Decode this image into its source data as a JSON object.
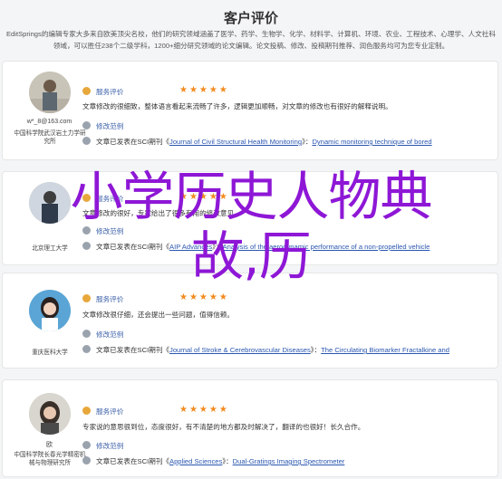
{
  "header": {
    "title": "客户评价",
    "subtitle": "EditSprings的编辑专家大多来自欧美顶尖名校，他们的研究领域涵盖了医学、药学、生物学、化学、材料学、计算机、环境、农业、工程技术、心理学、人文社科领域，可以胜任238个二级学科，1200+细分研究领域的论文编辑。论文投稿、修改、投稿期刊推荐、润色服务均可为您专业定制。"
  },
  "reviews": [
    {
      "user": "w*_8@163.com",
      "org": "中国科学院武汉岩土力学研究所",
      "service_label": "服务评价",
      "rating": 5,
      "stars": "★★★★★",
      "comment": "文章修改的很细致，整体语言看起来流畅了许多，逻辑更加顺畅，对文章的修改也有很好的解释说明。",
      "case_label": "修改范例",
      "pub_prefix": "文章已发表在SCI期刊",
      "journal": "Journal of Civil Structural Health Monitoring",
      "paper_title": "Dynamic monitoring technique of bored"
    },
    {
      "user": "",
      "org": "北京理工大学",
      "service_label": "服务评价",
      "rating": 5,
      "stars": "★★★★★",
      "comment": "文章修改的很好，专家给出了很多有用的修改意见。",
      "case_label": "修改范例",
      "pub_prefix": "文章已发表在SCI期刊",
      "journal": "AIP Advances",
      "paper_title": "Analysis of the aerodynamic performance of a non-propelled vehicle"
    },
    {
      "user": "",
      "org": "重庆医科大学",
      "service_label": "服务评价",
      "rating": 5,
      "stars": "★★★★★",
      "comment": "文章修改很仔细，还会提出一些问题，值得信赖。",
      "case_label": "修改范例",
      "pub_prefix": "文章已发表在SCI期刊",
      "journal": "Journal of Stroke & Cerebrovascular Diseases",
      "paper_title": "The Circulating Biomarker Fractalkine and"
    },
    {
      "user": "欧",
      "org": "中国科学院长春光学精密机械与物理研究所",
      "service_label": "服务评价",
      "rating": 5,
      "stars": "★★★★★",
      "comment": "专家说的意思很到位，态度很好，有不清楚的地方都及时解决了，翻译的也很好！长久合作。",
      "case_label": "修改范例",
      "pub_prefix": "文章已发表在SCI期刊",
      "journal": "Applied Sciences",
      "paper_title": "Dual-Gratings Imaging Spectrometer"
    }
  ],
  "overlay": {
    "line1": "小学历史人物典",
    "line2": "故,历"
  }
}
